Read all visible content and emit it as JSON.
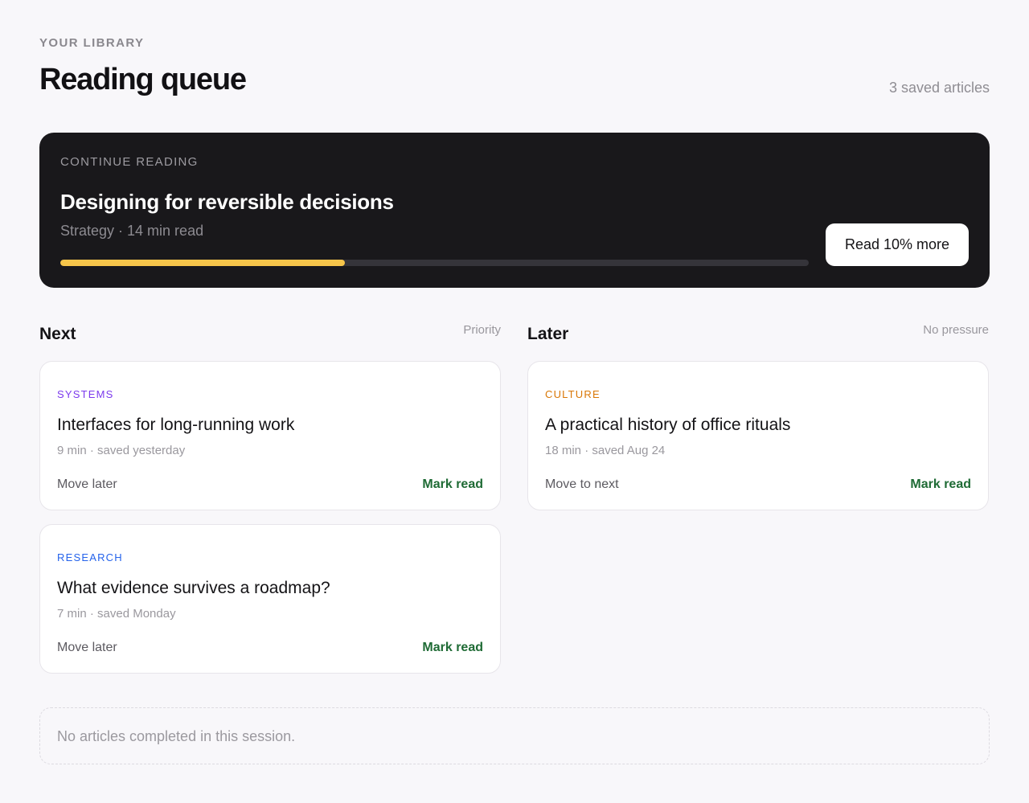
{
  "header": {
    "eyebrow": "YOUR LIBRARY",
    "title": "Reading queue",
    "count": "3 saved articles"
  },
  "hero": {
    "eyebrow": "CONTINUE READING",
    "title": "Designing for reversible decisions",
    "meta": "Strategy · 14 min read",
    "progress_percent": 38,
    "button_label": "Read 10% more",
    "progress_color": "#f6c54a"
  },
  "columns": [
    {
      "title": "Next",
      "note": "Priority",
      "cards": [
        {
          "tag": "SYSTEMS",
          "tag_color": "#7c3aed",
          "title": "Interfaces for long-running work",
          "meta": "9 min · saved yesterday",
          "action": "Move later",
          "mark": "Mark read"
        },
        {
          "tag": "RESEARCH",
          "tag_color": "#2563eb",
          "title": "What evidence survives a roadmap?",
          "meta": "7 min · saved Monday",
          "action": "Move later",
          "mark": "Mark read"
        }
      ]
    },
    {
      "title": "Later",
      "note": "No pressure",
      "cards": [
        {
          "tag": "CULTURE",
          "tag_color": "#d97706",
          "title": "A practical history of office rituals",
          "meta": "18 min · saved Aug 24",
          "action": "Move to next",
          "mark": "Mark read"
        }
      ]
    }
  ],
  "empty_state": {
    "text": "No articles completed in this session."
  },
  "colors": {
    "mark_read": "#1f6b35"
  }
}
